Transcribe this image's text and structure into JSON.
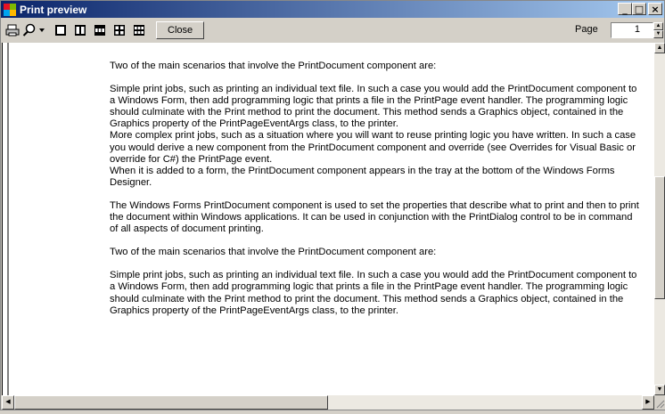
{
  "window": {
    "title": "Print preview",
    "controls": {
      "minimize": "_",
      "maximize": "□",
      "close": "×"
    }
  },
  "toolbar": {
    "close_label": "Close",
    "page_label": "Page",
    "page_value": "1",
    "icons": [
      "print-icon",
      "zoom-icon",
      "zoom-dropdown-icon",
      "one-page-icon",
      "two-pages-icon",
      "three-pages-icon",
      "four-pages-icon",
      "six-pages-icon"
    ]
  },
  "document": {
    "paragraphs": [
      "Two of the main scenarios that involve the PrintDocument component are:",
      "Simple print jobs, such as printing an individual text file. In such a case you would add the PrintDocument component to a Windows Form, then add programming logic that prints a file in the PrintPage event handler. The programming logic should culminate with the Print method to print the document. This method sends a Graphics object, contained in the Graphics property of the PrintPageEventArgs class, to the printer.",
      "More complex print jobs, such as a situation where you will want to reuse printing logic you have written. In such a case you would derive a new component from the PrintDocument component and override (see Overrides for Visual Basic or override for C#) the PrintPage event.",
      "When it is added to a form, the PrintDocument component appears in the tray at the bottom of the Windows Forms Designer.",
      "The Windows Forms PrintDocument component is used to set the properties that describe what to print and then to print the document within Windows applications. It can be used in conjunction with the PrintDialog control to be in command of all aspects of document printing.",
      "Two of the main scenarios that involve the PrintDocument component are:",
      "Simple print jobs, such as printing an individual text file. In such a case you would add the PrintDocument component to a Windows Form, then add programming logic that prints a file in the PrintPage event handler. The programming logic should culminate with the Print method to print the document. This method sends a Graphics object, contained in the Graphics property of the PrintPageEventArgs class, to the printer."
    ]
  },
  "scrollbars": {
    "up": "▲",
    "down": "▼",
    "left": "◀",
    "right": "▶"
  }
}
